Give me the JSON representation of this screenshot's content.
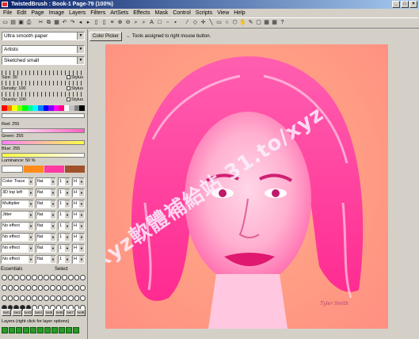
{
  "window": {
    "title": "TwistedBrush : Book-1 Page-79 (100%)"
  },
  "menu": [
    "File",
    "Edit",
    "Page",
    "Image",
    "Layers",
    "Filters",
    "ArtSets",
    "Effects",
    "Mask",
    "Control",
    "Scripts",
    "View",
    "Help"
  ],
  "toolbar_icons": [
    "new-icon",
    "open-icon",
    "save-icon",
    "print-icon",
    "cut-icon",
    "copy-icon",
    "paste-icon",
    "undo-icon",
    "redo-icon",
    "page-back-icon",
    "page-forward-icon",
    "zoom-in-icon",
    "zoom-out-icon",
    "eyedropper-icon",
    "select-icon",
    "line-icon",
    "rect-icon",
    "ellipse-icon",
    "polygon-icon",
    "hand-icon",
    "brush-icon",
    "grid-icon",
    "help-icon"
  ],
  "panel": {
    "paper_select": "Ultra smooth paper",
    "category_select": "Artists",
    "brush_select": "Sketched small",
    "size_label": "Size: 30",
    "density_label": "Density: 100",
    "opacity_label": "Opacity: 100",
    "stylus_label": "Stylus",
    "red_label": "Red: 255",
    "green_label": "Green: 255",
    "blue_label": "Blue: 255",
    "luminance_label": "Luminance: 50 %",
    "effects": [
      {
        "name": "Color Trace",
        "mode": "flat",
        "v1": "1",
        "v2": "H"
      },
      {
        "name": "3D top left",
        "mode": "flat",
        "v1": "1",
        "v2": "H"
      },
      {
        "name": "Multiplier",
        "mode": "flat",
        "v1": "1",
        "v2": "H"
      },
      {
        "name": "Jitter",
        "mode": "flat",
        "v1": "1",
        "v2": "H"
      },
      {
        "name": "No effect",
        "mode": "flat",
        "v1": "1",
        "v2": "H"
      },
      {
        "name": "No effect",
        "mode": "flat",
        "v1": "1",
        "v2": "H"
      },
      {
        "name": "No effect",
        "mode": "flat",
        "v1": "1",
        "v2": "H"
      },
      {
        "name": "No effect",
        "mode": "flat",
        "v1": "1",
        "v2": "H"
      }
    ],
    "essentials_label": "Essentials",
    "select_label": "Select",
    "sets": [
      "Set1",
      "Set2",
      "Set3",
      "Set4",
      "Set5",
      "Set6",
      "Set7",
      "Set8"
    ],
    "layers_label": "Layers (right click for layer options)"
  },
  "canvas_header": {
    "color_picker": "Color Picker",
    "hint": "Tools assigned to right mouse button."
  },
  "watermark": "xyz軟體補給站 31.to/xyz",
  "signature": "Tyler Smith",
  "colors": {
    "titlebar": "#0a246a",
    "canvas_bg": "#ff9e84",
    "hair": "#ff3aa0"
  }
}
